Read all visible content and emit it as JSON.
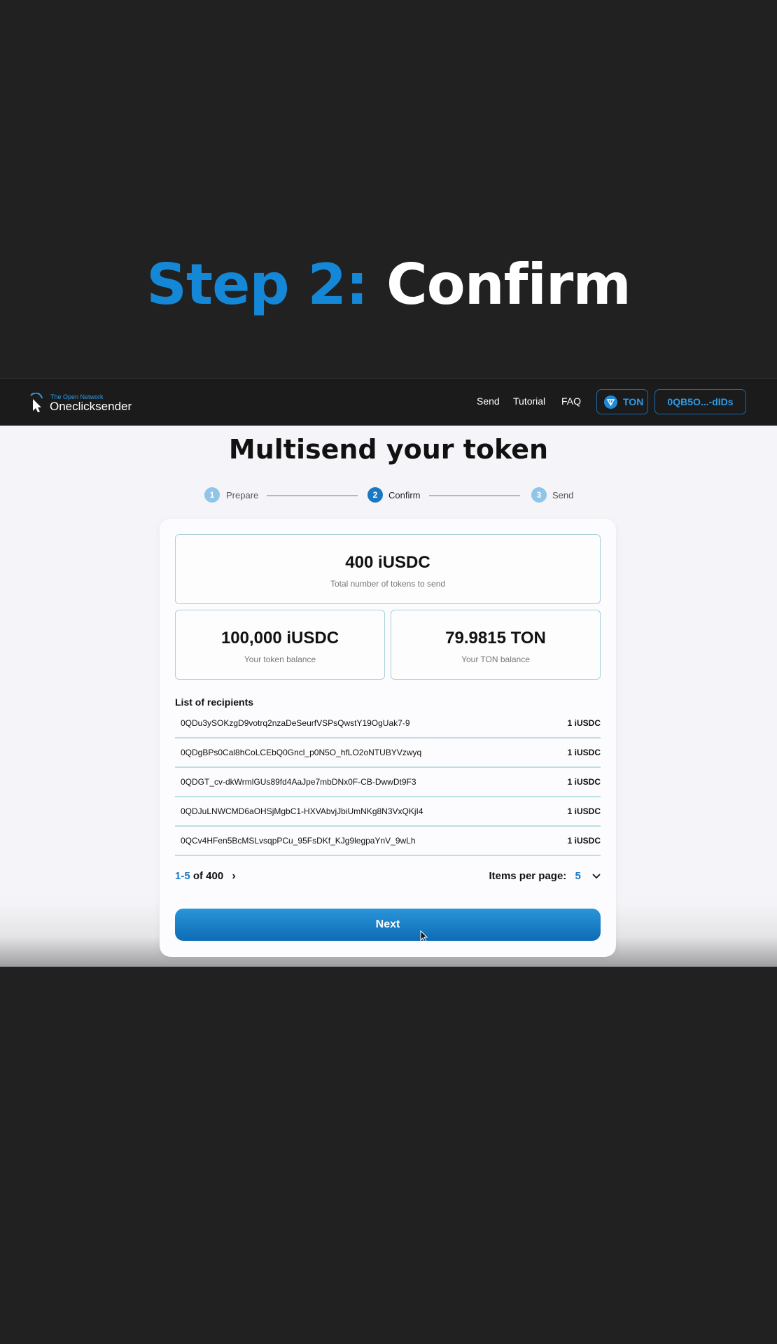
{
  "overlay": {
    "step_prefix": "Step 2:",
    "step_title": "Confirm"
  },
  "navbar": {
    "logo_small": "The Open Network",
    "logo_name": "Oneclicksender",
    "links": [
      "Send",
      "Tutorial",
      "FAQ"
    ],
    "network_button": "TON",
    "wallet_button": "0QB5O...-dIDs"
  },
  "page": {
    "title": "Multisend your token",
    "steps": [
      {
        "num": "1",
        "label": "Prepare",
        "color": "#8ec5e8"
      },
      {
        "num": "2",
        "label": "Confirm",
        "color": "#1b79c4"
      },
      {
        "num": "3",
        "label": "Send",
        "color": "#8ec5e8"
      }
    ]
  },
  "summary": {
    "total": {
      "value": "400 iUSDC",
      "label": "Total number of tokens to send"
    },
    "token_balance": {
      "value": "100,000 iUSDC",
      "label": "Your token balance"
    },
    "ton_balance": {
      "value": "79.9815 TON",
      "label": "Your TON balance"
    }
  },
  "recipients": {
    "title": "List of recipients",
    "rows": [
      {
        "address": "0QDu3ySOKzgD9votrq2nzaDeSeurfVSPsQwstY19OgUak7-9",
        "amount": "1 iUSDC"
      },
      {
        "address": "0QDgBPs0Cal8hCoLCEbQ0Gncl_p0N5O_hfLO2oNTUBYVzwyq",
        "amount": "1 iUSDC"
      },
      {
        "address": "0QDGT_cv-dkWrmlGUs89fd4AaJpe7mbDNx0F-CB-DwwDt9F3",
        "amount": "1 iUSDC"
      },
      {
        "address": "0QDJuLNWCMD6aOHSjMgbC1-HXVAbvjJbiUmNKg8N3VxQKjI4",
        "amount": "1 iUSDC"
      },
      {
        "address": "0QCv4HFen5BcMSLvsqpPCu_95FsDKf_KJg9legpaYnV_9wLh",
        "amount": "1 iUSDC"
      }
    ]
  },
  "pagination": {
    "range": "1-5",
    "of_total": " of 400",
    "items_per_page_label": "Items per page:",
    "items_per_page_value": "5"
  },
  "next_button": "Next",
  "colors": {
    "accent": "#1488d6",
    "navbar_bg": "#1b1b1c",
    "background": "#212121"
  }
}
